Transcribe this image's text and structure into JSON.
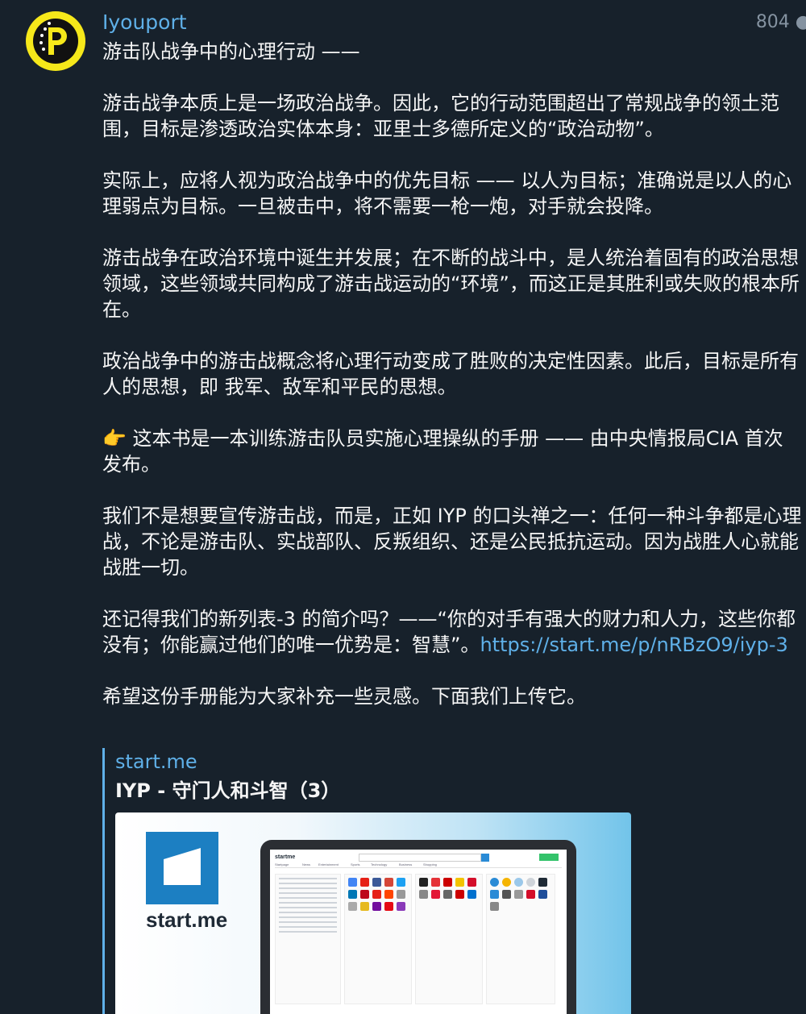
{
  "channel": {
    "name": "Iyouport",
    "views": "804 ●"
  },
  "message": {
    "title": "游击队战争中的心理行动 ——",
    "paragraphs": [
      "游击战争本质上是一场政治战争。因此，它的行动范围超出了常规战争的领土范围，目标是渗透政治实体本身：亚里士多德所定义的“政治动物”。",
      "实际上，应将人视为政治战争中的优先目标 —— 以人为目标；准确说是以人的心理弱点为目标。一旦被击中，将不需要一枪一炮，对手就会投降。",
      "游击战争在政治环境中诞生并发展；在不断的战斗中，是人统治着固有的政治思想领域，这些领域共同构成了游击战运动的“环境”，而这正是其胜利或失败的根本所在。",
      "政治战争中的游击战概念将心理行动变成了胜败的决定性因素。此后，目标是所有人的思想，即 我军、敌军和平民的思想。",
      "👉 这本书是一本训练游击队员实施心理操纵的手册 —— 由中央情报局CIA 首次发布。",
      "我们不是想要宣传游击战，而是，正如 IYP 的口头禅之一：任何一种斗争都是心理战，不论是游击队、实战部队、反叛组织、还是公民抵抗运动。因为战胜人心就能战胜一切。"
    ],
    "quote_text": "还记得我们的新列表-3 的简介吗？——“你的对手有强大的财力和人力，这些你都没有；你能赢过他们的唯一优势是：智慧”。",
    "link": "https://start.me/p/nRBzO9/iyp-3",
    "closing": "希望这份手册能为大家补充一些灵感。下面我们上传它。"
  },
  "preview": {
    "site": "start.me",
    "title": "IYP - 守门人和斗智（3）",
    "logo_text": "start.me",
    "screen_brand": "startme",
    "screen_tabs": [
      "Startpage",
      "News",
      "Entertainment",
      "Sports",
      "Technology",
      "Business",
      "Shopping"
    ]
  },
  "colors": {
    "background": "#17212b",
    "accent": "#5fb0e8",
    "avatar": "#f6e81a"
  }
}
